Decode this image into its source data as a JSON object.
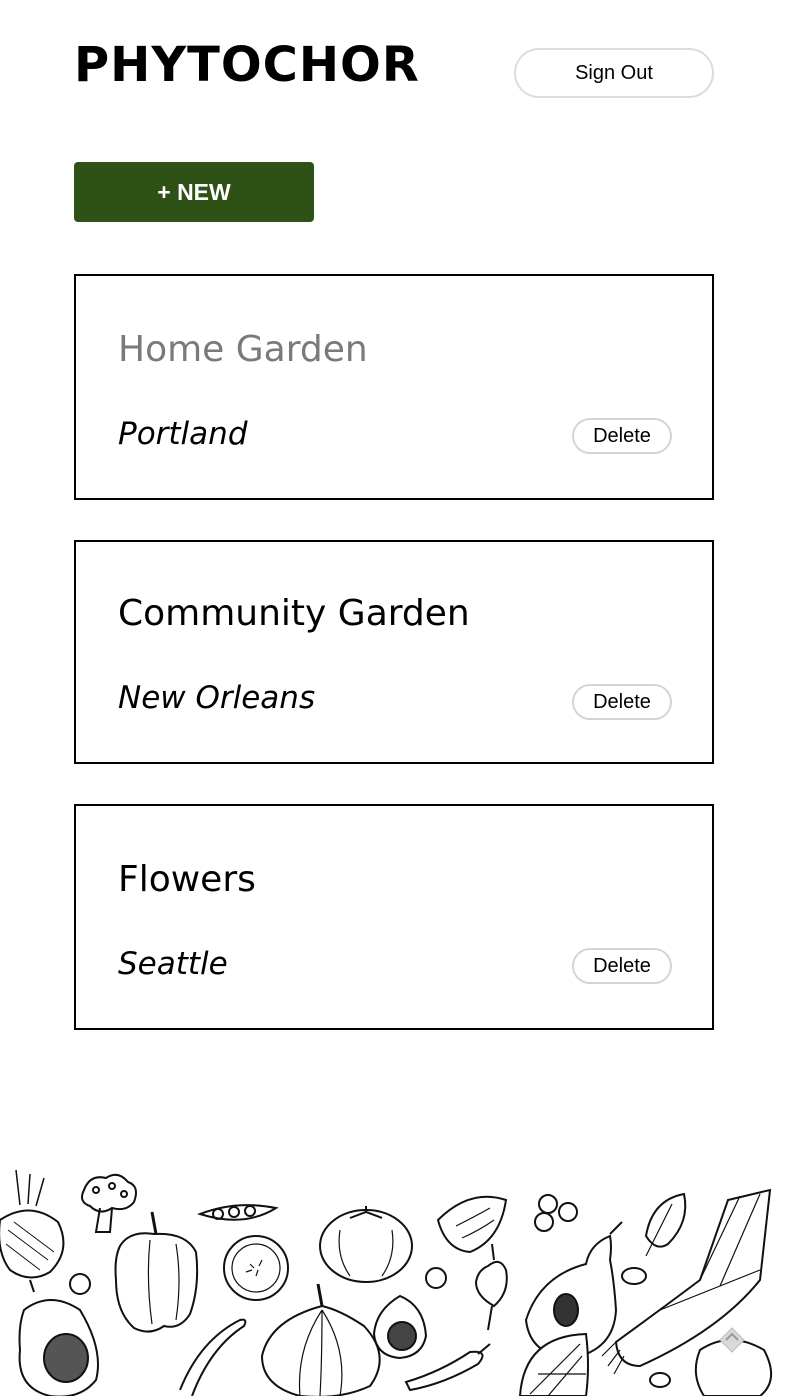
{
  "header": {
    "app_title": "PHYTOCHOR",
    "signout_label": "Sign Out"
  },
  "actions": {
    "new_label": "+ NEW"
  },
  "gardens": [
    {
      "name": "Home Garden",
      "location": "Portland",
      "delete_label": "Delete"
    },
    {
      "name": "Community Garden",
      "location": "New Orleans",
      "delete_label": "Delete"
    },
    {
      "name": "Flowers",
      "location": "Seattle",
      "delete_label": "Delete"
    }
  ],
  "colors": {
    "accent": "#2e5116",
    "card_border": "#000000",
    "muted_text": "#7a7a7a"
  },
  "icons": {
    "footer_art": "vegetable-sketch-illustration",
    "scroll_top": "chevron-up-icon"
  }
}
